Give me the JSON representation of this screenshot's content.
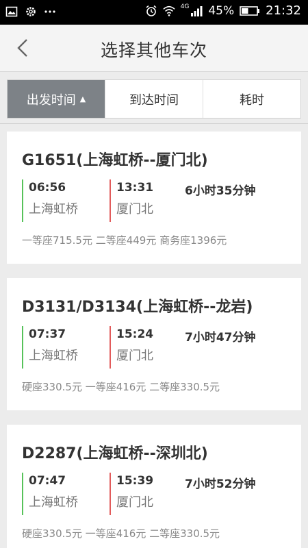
{
  "statusbar": {
    "battery": "45%",
    "time": "21:32",
    "network": "4G",
    "icons": [
      "image-icon",
      "gear-icon",
      "more-icon",
      "alarm-icon",
      "wifi-icon",
      "signal-icon",
      "battery-icon"
    ]
  },
  "header": {
    "title": "选择其他车次",
    "back_icon": "chevron-left-icon"
  },
  "tabs": [
    {
      "label": "出发时间",
      "active": true,
      "arrow": "▲"
    },
    {
      "label": "到达时间",
      "active": false
    },
    {
      "label": "耗时",
      "active": false
    }
  ],
  "trains": [
    {
      "name": "G1651(上海虹桥--厦门北)",
      "dep_time": "06:56",
      "dep_station": "上海虹桥",
      "arr_time": "13:31",
      "arr_station": "厦门北",
      "duration": "6小时35分钟",
      "prices": "一等座715.5元  二等座449元  商务座1396元"
    },
    {
      "name": "D3131/D3134(上海虹桥--龙岩)",
      "dep_time": "07:37",
      "dep_station": "上海虹桥",
      "arr_time": "15:24",
      "arr_station": "厦门北",
      "duration": "7小时47分钟",
      "prices": "硬座330.5元  一等座416元  二等座330.5元"
    },
    {
      "name": "D2287(上海虹桥--深圳北)",
      "dep_time": "07:47",
      "dep_station": "上海虹桥",
      "arr_time": "15:39",
      "arr_station": "厦门北",
      "duration": "7小时52分钟",
      "prices": "硬座330.5元  一等座416元  二等座330.5元"
    }
  ],
  "colors": {
    "active_tab": "#7d8287",
    "departure_line": "#57c25a",
    "arrival_line": "#e25b5b"
  }
}
